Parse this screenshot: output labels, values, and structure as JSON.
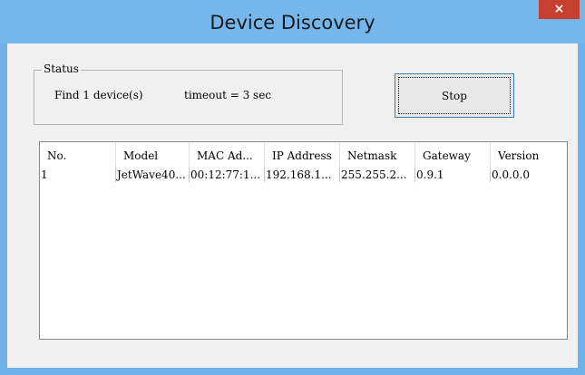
{
  "window": {
    "title": "Device Discovery",
    "close_label": "×"
  },
  "status": {
    "legend": "Status",
    "found": "Find 1 device(s)",
    "timeout": "timeout = 3 sec"
  },
  "stop_button": {
    "label": "Stop"
  },
  "table": {
    "columns": [
      "No.",
      "Model",
      "MAC Ad...",
      "IP Address",
      "Netmask",
      "Gateway",
      "Version"
    ],
    "rows": [
      [
        "1",
        "JetWave40...",
        "00:12:77:1...",
        "192.168.1...",
        "255.255.2...",
        "0.9.1",
        "0.0.0.0"
      ]
    ]
  },
  "colors": {
    "titlebar": "#75b6ec",
    "close": "#c7402f",
    "client": "#f0f0f0"
  }
}
